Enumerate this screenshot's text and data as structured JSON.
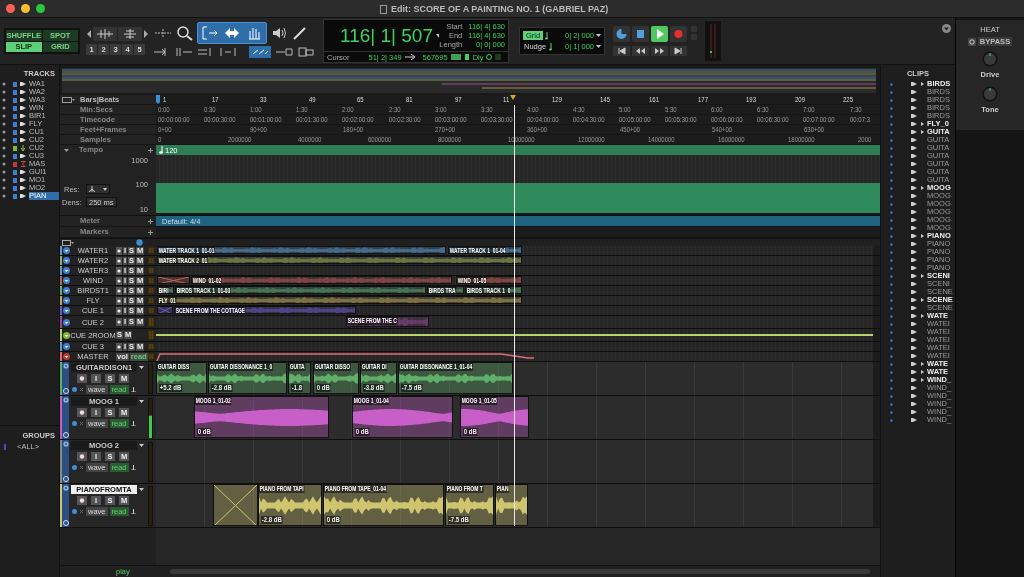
{
  "window": {
    "title": "Edit: SCORE OF A PAINTING NO. 1 (GABRIEL PAZ)"
  },
  "edit_modes": [
    {
      "label": "SHUFFLE",
      "selected": false
    },
    {
      "label": "SPOT",
      "selected": false
    },
    {
      "label": "SLIP",
      "selected": true
    },
    {
      "label": "GRID",
      "selected": false
    }
  ],
  "zoom_presets": [
    "1",
    "2",
    "3",
    "4",
    "5"
  ],
  "smart_tool": {
    "on": true
  },
  "counter": {
    "main": "116| 1| 507",
    "start_label": "Start",
    "start": "116| 4| 630",
    "end_label": "End",
    "end": "116| 4| 630",
    "length_label": "Length",
    "length": "0| 0| 000",
    "cursor_label": "Cursor",
    "cursor": "51| 2| 349",
    "samples": "567695",
    "delay": "Dly"
  },
  "grid": {
    "label": "Grid",
    "value": "0| 2| 000"
  },
  "nudge": {
    "label": "Nudge",
    "value": "0| 1| 000"
  },
  "transport": {
    "playing": true
  },
  "tracks_panel": {
    "title": "TRACKS",
    "items": [
      {
        "name": "WA1",
        "kind": "audio",
        "selected": false
      },
      {
        "name": "WA2",
        "kind": "audio",
        "selected": false
      },
      {
        "name": "WA3",
        "kind": "audio",
        "selected": false
      },
      {
        "name": "WIN",
        "kind": "audio",
        "selected": false
      },
      {
        "name": "BIR1",
        "kind": "audio",
        "selected": false
      },
      {
        "name": "FLY",
        "kind": "audio",
        "selected": false
      },
      {
        "name": "CU1",
        "kind": "audio",
        "selected": false
      },
      {
        "name": "CU2",
        "kind": "audio",
        "selected": false
      },
      {
        "name": "CU2",
        "kind": "aux",
        "selected": false
      },
      {
        "name": "CU3",
        "kind": "audio",
        "selected": false
      },
      {
        "name": "MAS",
        "kind": "master",
        "selected": false
      },
      {
        "name": "GUI1",
        "kind": "audio",
        "selected": false
      },
      {
        "name": "MO1",
        "kind": "audio",
        "selected": false
      },
      {
        "name": "MO2",
        "kind": "audio",
        "selected": false
      },
      {
        "name": "PIAN",
        "kind": "audio",
        "selected": true
      }
    ]
  },
  "groups_panel": {
    "title": "GROUPS",
    "items": [
      "<ALL>"
    ]
  },
  "rulers": [
    {
      "label": "Bars|Beats",
      "ticks": [
        "1",
        "17",
        "33",
        "49",
        "65",
        "81",
        "97",
        "11",
        "129",
        "145",
        "161",
        "177",
        "193",
        "209",
        "225"
      ]
    },
    {
      "label": "Min:Secs",
      "ticks": [
        "0:00",
        "0:30",
        "1:00",
        "1:30",
        "2:00",
        "2:30",
        "3:00",
        "3:30",
        "4:00",
        "4:30",
        "5:00",
        "5:30",
        "6:00",
        "6:30",
        "7:00",
        "7:30"
      ]
    },
    {
      "label": "Timecode",
      "ticks": [
        "00:00:00:00",
        "00:00:30:00",
        "00:01:00:00",
        "00:01:30:00",
        "00:02:00:00",
        "00:02:30:00",
        "00:03:00:00",
        "00:03:30:00",
        "00:04:00:00",
        "00:04:30:00",
        "00:05:00:00",
        "00:05:30:00",
        "00:06:00:00",
        "00:06:30:00",
        "00:07:00:00",
        "00:07:3"
      ]
    },
    {
      "label": "Feet+Frames",
      "ticks": [
        "0+00",
        "90+00",
        "180+00",
        "270+00",
        "360+00",
        "450+00",
        "540+00",
        "630+00"
      ]
    },
    {
      "label": "Samples",
      "ticks": [
        "0",
        "2000000",
        "4000000",
        "6000000",
        "8000000",
        "10000000",
        "12000000",
        "14000000",
        "16000000",
        "18000000",
        "2000"
      ]
    }
  ],
  "tempo": {
    "label": "Tempo",
    "value": "120",
    "scale": [
      "1000",
      "100",
      "10"
    ],
    "res_label": "Res:",
    "dens_label": "Dens:",
    "dens": "250 ms"
  },
  "meter": {
    "label": "Meter",
    "value": "Default: 4/4"
  },
  "markers": {
    "label": "Markers"
  },
  "tracks": [
    {
      "name": "WATER1",
      "kind": "audio",
      "selected": false,
      "color": "#5a9fd8",
      "buttons": [
        "I",
        "S",
        "M"
      ],
      "clips": [
        {
          "kind": "clip",
          "name": "WATER TRACK 1_01-01"
        },
        {
          "kind": "clip",
          "name": "WATER TRACK 1_01-04"
        }
      ]
    },
    {
      "name": "WATER2",
      "kind": "audio",
      "selected": false,
      "color": "#9bb060",
      "buttons": [
        "I",
        "S",
        "M"
      ],
      "clips": [
        {
          "kind": "clip",
          "name": "WATER TRACK 2_01"
        }
      ]
    },
    {
      "name": "WATER3",
      "kind": "audio",
      "selected": false,
      "color": "#5a9fd8",
      "buttons": [
        "I",
        "S",
        "M"
      ]
    },
    {
      "name": "WIND",
      "kind": "audio",
      "selected": false,
      "color": "#c0605a",
      "buttons": [
        "I",
        "S",
        "M"
      ],
      "clips": [
        {
          "kind": "fade"
        },
        {
          "kind": "clip",
          "name": "WIND_01-02"
        },
        {
          "kind": "clip",
          "name": "WIND_01-05"
        }
      ]
    },
    {
      "name": "BIRDST1",
      "kind": "audio",
      "selected": false,
      "color": "#5fb07a",
      "buttons": [
        "I",
        "S",
        "M"
      ],
      "clips": [
        {
          "kind": "clip",
          "name": "BIRI"
        },
        {
          "kind": "clip",
          "name": "BIRDS TRACK 1_01-03"
        },
        {
          "kind": "clip",
          "name": "BIRDS TRA"
        },
        {
          "kind": "clip",
          "name": "BIRDS TRACK 1_0"
        }
      ]
    },
    {
      "name": "FLY",
      "kind": "audio",
      "selected": false,
      "color": "#bfa85a",
      "buttons": [
        "I",
        "S",
        "M"
      ],
      "clips": [
        {
          "kind": "clip",
          "name": "FLY_01"
        }
      ]
    },
    {
      "name": "CUE 1",
      "kind": "audio",
      "selected": false,
      "color": "#6a5ad0",
      "buttons": [
        "I",
        "S",
        "M"
      ],
      "clips": [
        {
          "kind": "fade"
        },
        {
          "kind": "clip",
          "name": "SCENE FROM THE COTTAGE"
        }
      ]
    },
    {
      "name": "CUE 2",
      "kind": "audio",
      "selected": false,
      "color": "#9a4a9a",
      "buttons": [
        "I",
        "S",
        "M"
      ],
      "clips": [
        {
          "kind": "clip",
          "name": "SCENE FROM THE C"
        }
      ]
    },
    {
      "name": "CUE 2ROOM",
      "kind": "aux",
      "selected": false,
      "color": "#b5d36a",
      "buttons": [
        "S",
        "M"
      ]
    },
    {
      "name": "CUE 3",
      "kind": "audio",
      "selected": false,
      "color": "#5a9fd8",
      "buttons": [
        "I",
        "S",
        "M"
      ]
    },
    {
      "name": "MASTER",
      "kind": "master",
      "selected": false,
      "color": "#e06a78",
      "buttons": [
        "vol",
        "read"
      ]
    },
    {
      "name": "GUITARDISON1",
      "kind": "audio",
      "selected": false,
      "color": "#5fae6a",
      "buttons": [
        "I",
        "S",
        "M"
      ],
      "view": "wave",
      "automation": "read",
      "clips": [
        {
          "kind": "clip",
          "name": "GUITAR DISS",
          "gain": "+5.2 dB"
        },
        {
          "kind": "clip",
          "name": "GUITAR DISSONANCE 1_0",
          "gain": "-2.8 dB"
        },
        {
          "kind": "clip",
          "name": "GUITA",
          "gain": "-1.8"
        },
        {
          "kind": "clip",
          "name": "GUITAR DISSO",
          "gain": "0 dB"
        },
        {
          "kind": "clip",
          "name": "GUITAR DI",
          "gain": "-3.8 dB"
        },
        {
          "kind": "clip",
          "name": "GUITAR DISSONANCE 1_01-04",
          "gain": "-7.5 dB"
        }
      ]
    },
    {
      "name": "MOOG 1",
      "kind": "audio",
      "selected": false,
      "color": "#c85ec8",
      "buttons": [
        "I",
        "S",
        "M"
      ],
      "view": "wave",
      "automation": "read",
      "clips": [
        {
          "kind": "clip",
          "name": "MOOG 1_01-02",
          "gain": "0 dB"
        },
        {
          "kind": "clip",
          "name": "MOOG 1_01-04",
          "gain": "0 dB"
        },
        {
          "kind": "clip",
          "name": "MOOG 1_01-05",
          "gain": "0 dB"
        }
      ]
    },
    {
      "name": "MOOG 2",
      "kind": "audio",
      "selected": false,
      "color": "#8a8a8a",
      "buttons": [
        "I",
        "S",
        "M"
      ],
      "view": "wave",
      "automation": "read"
    },
    {
      "name": "PIANOFROMTA",
      "kind": "audio",
      "selected": true,
      "color": "#cfc56e",
      "buttons": [
        "I",
        "S",
        "M"
      ],
      "view": "wave",
      "automation": "read",
      "clips": [
        {
          "kind": "fade"
        },
        {
          "kind": "clip",
          "name": "PIANO FROM TAPI",
          "gain": "-2.8 dB"
        },
        {
          "kind": "clip",
          "name": "PIANO FROM TAPE_01-04",
          "gain": "0 dB"
        },
        {
          "kind": "clip",
          "name": "PIANO FROM T",
          "gain": "-7.5 dB"
        },
        {
          "kind": "clip",
          "name": "PIAN"
        }
      ]
    }
  ],
  "bottom_bar": {
    "mode": "play"
  },
  "clips_panel": {
    "title": "CLIPS",
    "items": [
      {
        "name": "BIRDS",
        "kind": "file"
      },
      {
        "name": "BIRDS",
        "kind": "clip"
      },
      {
        "name": "BIRDS",
        "kind": "clip"
      },
      {
        "name": "BIRDS",
        "kind": "clip"
      },
      {
        "name": "BIRDS",
        "kind": "clip"
      },
      {
        "name": "FLY_0",
        "kind": "file"
      },
      {
        "name": "GUITA",
        "kind": "file"
      },
      {
        "name": "GUITA",
        "kind": "clip"
      },
      {
        "name": "GUITA",
        "kind": "clip"
      },
      {
        "name": "GUITA",
        "kind": "clip"
      },
      {
        "name": "GUITA",
        "kind": "clip"
      },
      {
        "name": "GUITA",
        "kind": "clip"
      },
      {
        "name": "GUITA",
        "kind": "clip"
      },
      {
        "name": "MOOG",
        "kind": "file"
      },
      {
        "name": "MOOG",
        "kind": "clip"
      },
      {
        "name": "MOOG",
        "kind": "clip"
      },
      {
        "name": "MOOG",
        "kind": "clip"
      },
      {
        "name": "MOOG",
        "kind": "clip"
      },
      {
        "name": "MOOG",
        "kind": "clip"
      },
      {
        "name": "PIANO",
        "kind": "file"
      },
      {
        "name": "PIANO",
        "kind": "clip"
      },
      {
        "name": "PIANO",
        "kind": "clip"
      },
      {
        "name": "PIANO",
        "kind": "clip"
      },
      {
        "name": "PIANO",
        "kind": "clip"
      },
      {
        "name": "SCENI",
        "kind": "file"
      },
      {
        "name": "SCENI",
        "kind": "clip"
      },
      {
        "name": "SCENE",
        "kind": "clip"
      },
      {
        "name": "SCENE",
        "kind": "file"
      },
      {
        "name": "SCENE",
        "kind": "clip"
      },
      {
        "name": "WATE",
        "kind": "file"
      },
      {
        "name": "WATEI",
        "kind": "clip"
      },
      {
        "name": "WATEI",
        "kind": "clip"
      },
      {
        "name": "WATEI",
        "kind": "clip"
      },
      {
        "name": "WATEI",
        "kind": "clip"
      },
      {
        "name": "WATEI",
        "kind": "clip"
      },
      {
        "name": "WATE",
        "kind": "file"
      },
      {
        "name": "WATE",
        "kind": "file"
      },
      {
        "name": "WIND_",
        "kind": "file"
      },
      {
        "name": "WIND_",
        "kind": "clip"
      },
      {
        "name": "WIND_",
        "kind": "clip"
      },
      {
        "name": "WIND_",
        "kind": "clip"
      },
      {
        "name": "WIND_",
        "kind": "clip"
      },
      {
        "name": "WIND_",
        "kind": "clip"
      }
    ]
  },
  "plugin": {
    "title": "HEAT",
    "bypass": "BYPASS",
    "knobs": [
      "Drive",
      "Tone"
    ]
  }
}
